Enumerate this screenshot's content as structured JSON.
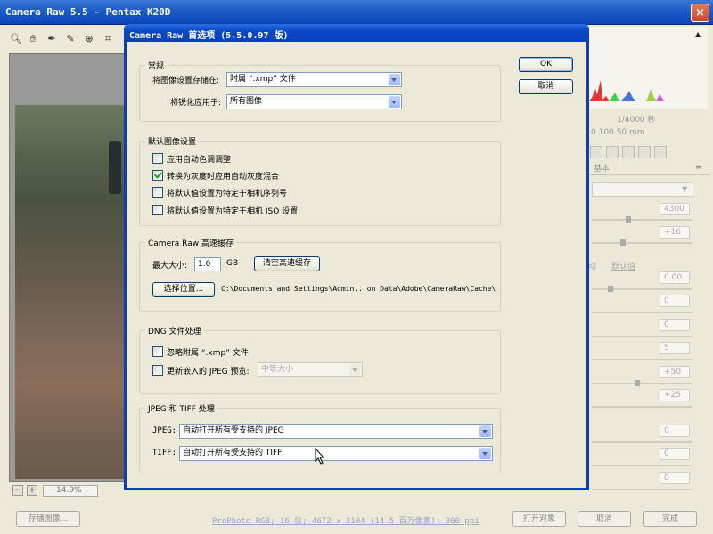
{
  "app": {
    "title": "Camera Raw 5.5 -  Pentax K20D",
    "close_label": "×"
  },
  "preview": {
    "zoom": "14.9%",
    "zoom_minus": "−",
    "zoom_plus": "+"
  },
  "bottom_bar": {
    "save_label": "存储图像...",
    "workflow_text": "ProPhoto RGB; 16 位; 4672 x 3104 (14.5 百万像素); 300 ppi",
    "open_label": "打开对象",
    "cancel_label": "取消",
    "done_label": "完成"
  },
  "right_panel": {
    "shutter": "1/4000 秒",
    "lens": "0   100   50 mm",
    "panel_title": "基本",
    "auto_label": "动",
    "default_label": "默认值",
    "values": [
      "4300",
      "+16",
      "0.00",
      "0",
      "0",
      "5",
      "+50",
      "+25",
      "0",
      "0",
      "0"
    ]
  },
  "dialog": {
    "title": "Camera Raw 首选项  (5.5.0.97 版)",
    "ok_label": "OK",
    "cancel_label": "取消",
    "general": {
      "title": "常规",
      "save_settings_label": "将图像设置存储在:",
      "save_settings_value": "附属 “.xmp” 文件",
      "sharpen_label": "将锐化应用于:",
      "sharpen_value": "所有图像"
    },
    "defaults": {
      "title": "默认图像设置",
      "checkboxes": [
        {
          "label": "应用自动色调调整",
          "checked": false
        },
        {
          "label": "转换为灰度时应用自动灰度混合",
          "checked": true
        },
        {
          "label": "将默认值设置为特定于相机序列号",
          "checked": false
        },
        {
          "label": "将默认值设置为特定于相机 ISO 设置",
          "checked": false
        }
      ]
    },
    "cache": {
      "title": "Camera Raw 高速缓存",
      "max_size_label": "最大大小:",
      "max_size_value": "1.0",
      "unit": "GB",
      "purge_label": "清空高速缓存",
      "select_location_label": "选择位置...",
      "path": "C:\\Documents and Settings\\Admin...on Data\\Adobe\\CameraRaw\\Cache\\"
    },
    "dng": {
      "title": "DNG 文件处理",
      "ignore_xmp_label": "忽略附属 “.xmp” 文件",
      "ignore_xmp_checked": false,
      "update_preview_label": "更新嵌入的 JPEG 预览:",
      "update_preview_checked": false,
      "preview_size_value": "中等大小"
    },
    "jpeg_tiff": {
      "title": "JPEG 和 TIFF 处理",
      "jpeg_label": "JPEG:",
      "jpeg_value": "自动打开所有受支持的 JPEG",
      "tiff_label": "TIFF:",
      "tiff_value": "自动打开所有受支持的 TIFF"
    }
  }
}
